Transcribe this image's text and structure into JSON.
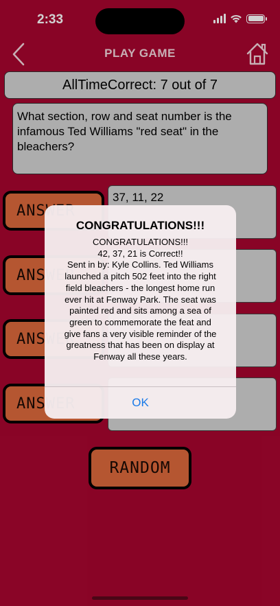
{
  "status": {
    "time": "2:33"
  },
  "nav": {
    "title": "PLAY GAME"
  },
  "score": {
    "text": "AllTimeCorrect: 7 out of 7"
  },
  "question": {
    "text": "What section, row and seat number is the infamous Ted Williams \"red seat\" in the bleachers?"
  },
  "answers": [
    {
      "button_label": "ANSWER",
      "value": "37, 11, 22"
    },
    {
      "button_label": "ANSWER",
      "value": ""
    },
    {
      "button_label": "ANSWER",
      "value": ""
    },
    {
      "button_label": "ANSWER",
      "value": ""
    }
  ],
  "random_button": {
    "label": "RANDOM"
  },
  "alert": {
    "title": "CONGRATULATIONS!!!",
    "message_lines": [
      "CONGRATULATIONS!!!",
      "42, 37, 21 is Correct!!",
      "Sent in by: Kyle Collins. Ted Williams",
      "launched a pitch 502 feet into the right",
      "field bleachers - the longest home run",
      "ever hit at Fenway Park. The seat was",
      "painted  red and sits among a sea of",
      "green to commemorate the feat and",
      "give fans a very  visible reminder of the",
      "greatness that has been on display at",
      "Fenway all these  years."
    ],
    "ok_label": "OK"
  },
  "colors": {
    "background": "#a8062f",
    "button": "#dd6a3c",
    "field": "#d3d3d3",
    "alert_action": "#1a7ae8"
  },
  "icons": [
    "back-chevron-icon",
    "home-icon",
    "wifi-icon",
    "signal-icon",
    "battery-icon"
  ]
}
